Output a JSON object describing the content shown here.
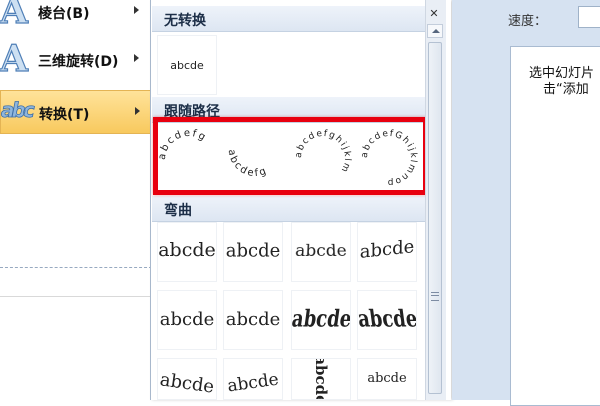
{
  "left_menu": {
    "items": [
      {
        "label": "棱台(B)"
      },
      {
        "label": "三维旋转(D)"
      },
      {
        "label": "转换(T)"
      }
    ]
  },
  "gallery": {
    "sections": [
      {
        "title": "无转换"
      },
      {
        "title": "跟随路径"
      },
      {
        "title": "弯曲"
      }
    ],
    "no_transform_tile": "abcde",
    "follow_path_tiles": [
      "abcdefg",
      "abcdefg",
      "abcdefghijklm",
      "abcdefGhijklmnop"
    ],
    "warp_tiles": [
      "abcde",
      "abcde",
      "abcde",
      "abcde",
      "abcde",
      "abcde",
      "abcde",
      "abcde",
      "abcde",
      "abcde",
      "abcde",
      "abcde"
    ],
    "close_glyph": "✕",
    "highlight_color": "#e8000f"
  },
  "right_pane": {
    "speed_label": "速度：",
    "hint_line1": "选中幻灯片",
    "hint_line2": "击“添加"
  }
}
